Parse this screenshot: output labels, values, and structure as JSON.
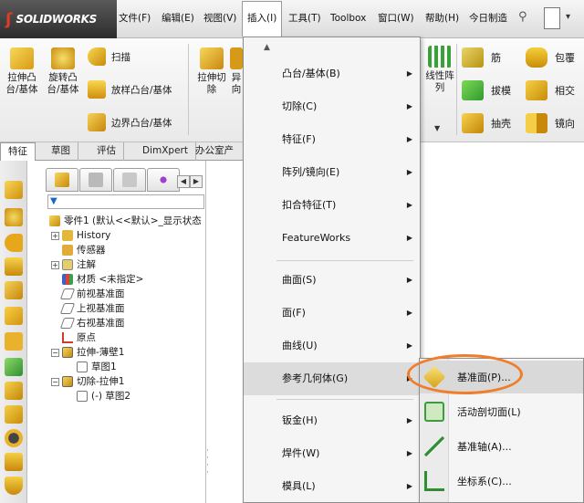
{
  "app": {
    "logo_text": "SOLIDWORKS"
  },
  "menubar": {
    "items": [
      "文件(F)",
      "编辑(E)",
      "视图(V)",
      "插入(I)",
      "工具(T)",
      "Toolbox",
      "窗口(W)",
      "帮助(H)",
      "今日制造"
    ]
  },
  "ribbon": {
    "extrude_boss": "拉伸凸\n台/基体",
    "revolve_boss": "旋转凸\n台/基体",
    "sweep": "扫描",
    "loft_boss": "放样凸台/基体",
    "boundary_boss": "边界凸台/基体",
    "extrude_cut": "拉伸切\n除",
    "partial_hole": "异\n向",
    "linear_pattern": "线性阵\n列",
    "rib": "筋",
    "wrap": "包覆",
    "draft": "拔模",
    "intersect": "相交",
    "shell": "抽壳",
    "mirror": "镜向"
  },
  "tabs": [
    "特征",
    "草图",
    "评估",
    "DimXpert",
    "办公室产品"
  ],
  "tree": {
    "root": "零件1 (默认<<默认>_显示状态",
    "items": [
      {
        "label": "History",
        "expandable": true
      },
      {
        "label": "传感器",
        "expandable": false
      },
      {
        "label": "注解",
        "expandable": true
      },
      {
        "label": "材质 <未指定>",
        "expandable": false
      },
      {
        "label": "前视基准面",
        "expandable": false
      },
      {
        "label": "上视基准面",
        "expandable": false
      },
      {
        "label": "右视基准面",
        "expandable": false
      },
      {
        "label": "原点",
        "expandable": false
      },
      {
        "label": "拉伸-薄壁1",
        "expandable": true
      },
      {
        "label": "草图1",
        "expandable": false
      },
      {
        "label": "切除-拉伸1",
        "expandable": true
      },
      {
        "label": "(-) 草图2",
        "expandable": false
      }
    ]
  },
  "insert_menu": {
    "items": [
      {
        "label": "凸台/基体(B)",
        "submenu": true
      },
      {
        "label": "切除(C)",
        "submenu": true
      },
      {
        "label": "特征(F)",
        "submenu": true
      },
      {
        "label": "阵列/镜向(E)",
        "submenu": true
      },
      {
        "label": "扣合特征(T)",
        "submenu": true
      },
      {
        "label": "FeatureWorks",
        "submenu": true
      },
      {
        "label": "曲面(S)",
        "submenu": true
      },
      {
        "label": "面(F)",
        "submenu": true
      },
      {
        "label": "曲线(U)",
        "submenu": true
      },
      {
        "label": "参考几何体(G)",
        "submenu": true,
        "highlighted": true
      },
      {
        "label": "钣金(H)",
        "submenu": true
      },
      {
        "label": "焊件(W)",
        "submenu": true
      },
      {
        "label": "模具(L)",
        "submenu": true
      }
    ]
  },
  "ref_geometry_submenu": {
    "items": [
      {
        "label": "基准面(P)...",
        "highlighted": true
      },
      {
        "label": "活动剖切面(L)"
      },
      {
        "label": "基准轴(A)..."
      },
      {
        "label": "坐标系(C)..."
      }
    ]
  },
  "colors": {
    "highlight_oval": "#ef7d2a",
    "menu_hover": "#dcdcdc"
  }
}
